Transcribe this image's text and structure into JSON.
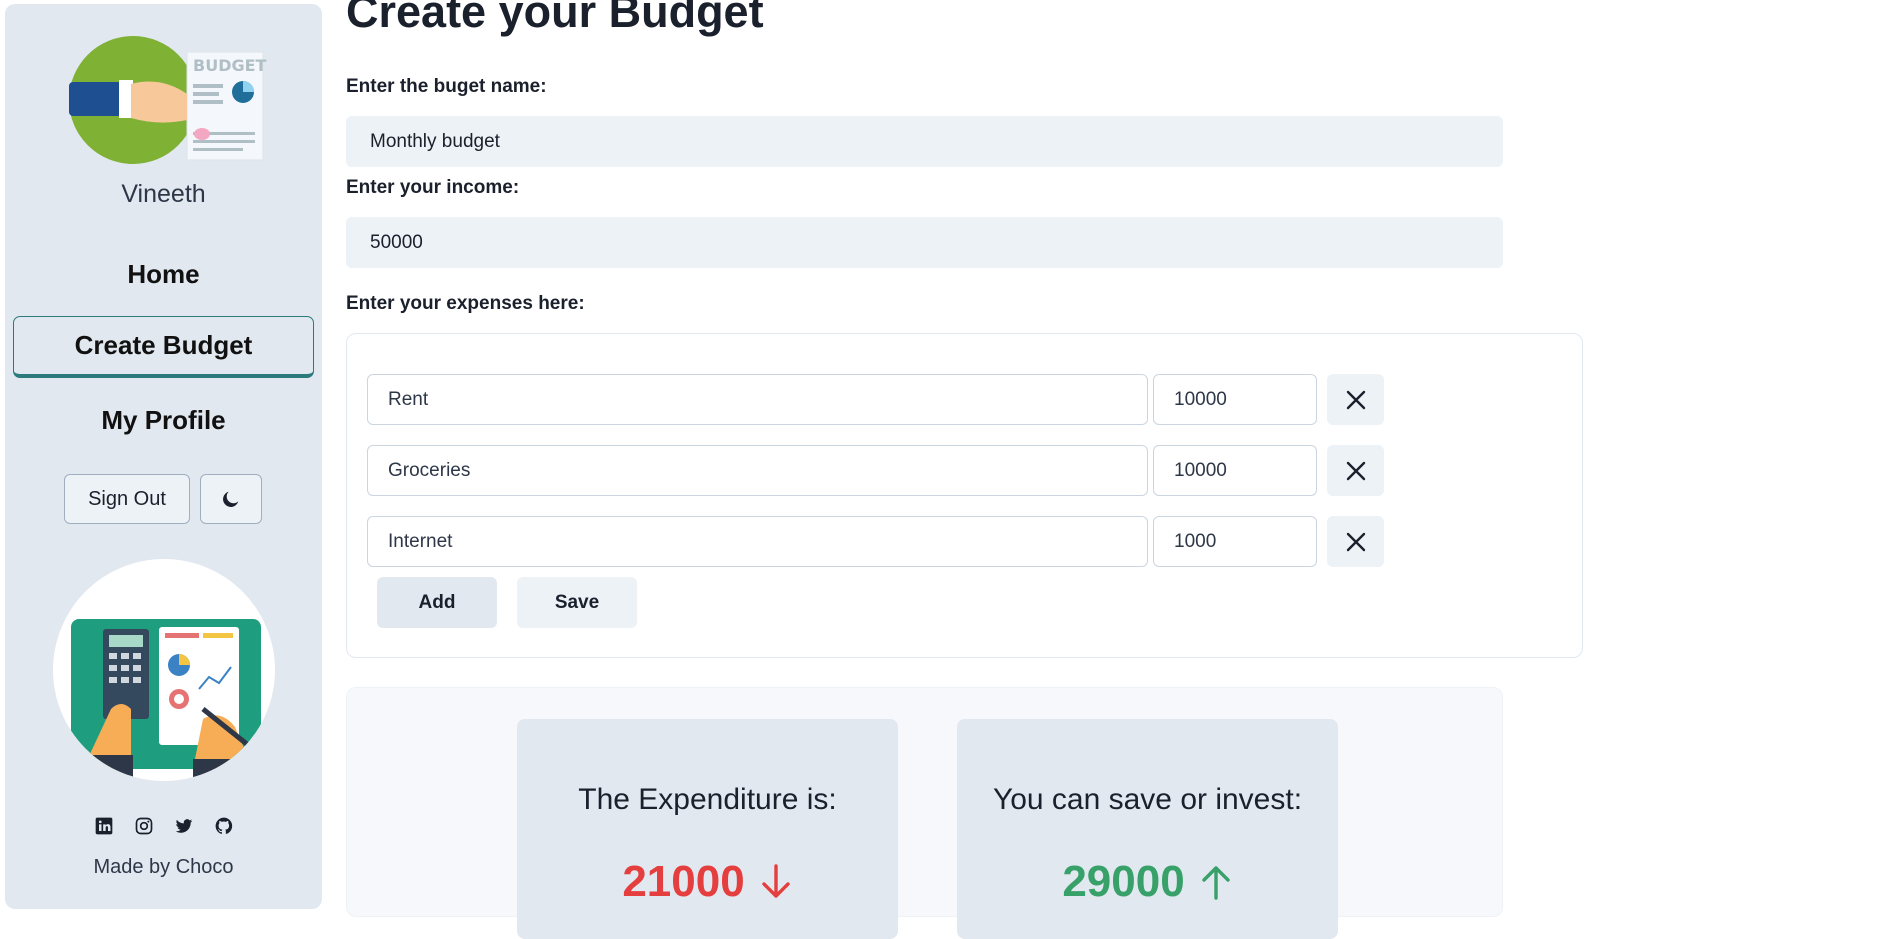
{
  "sidebar": {
    "username": "Vineeth",
    "nav": {
      "home": "Home",
      "create_budget": "Create Budget",
      "my_profile": "My Profile"
    },
    "sign_out": "Sign Out",
    "theme_toggle_icon": "moon-icon",
    "avatar_text": "BUDGET",
    "socials": [
      "linkedin-icon",
      "instagram-icon",
      "twitter-icon",
      "github-icon"
    ],
    "made_by": "Made by Choco"
  },
  "main": {
    "title": "Create your Budget",
    "budget_name_label": "Enter the buget name:",
    "budget_name_value": "Monthly budget",
    "income_label": "Enter your income:",
    "income_value": "50000",
    "expenses_label": "Enter your expenses here:",
    "expenses": [
      {
        "name": "Rent",
        "amount": "10000"
      },
      {
        "name": "Groceries",
        "amount": "10000"
      },
      {
        "name": "Internet",
        "amount": "1000"
      }
    ],
    "add_label": "Add",
    "save_label": "Save"
  },
  "summary": {
    "expenditure_title": "The Expenditure is:",
    "expenditure_value": "21000",
    "savings_title": "You can save or invest:",
    "savings_value": "29000"
  },
  "colors": {
    "sidebar_bg": "#e2e8f0",
    "accent": "#2c7a7b",
    "expenditure": "#e53e3e",
    "savings": "#38a169"
  }
}
